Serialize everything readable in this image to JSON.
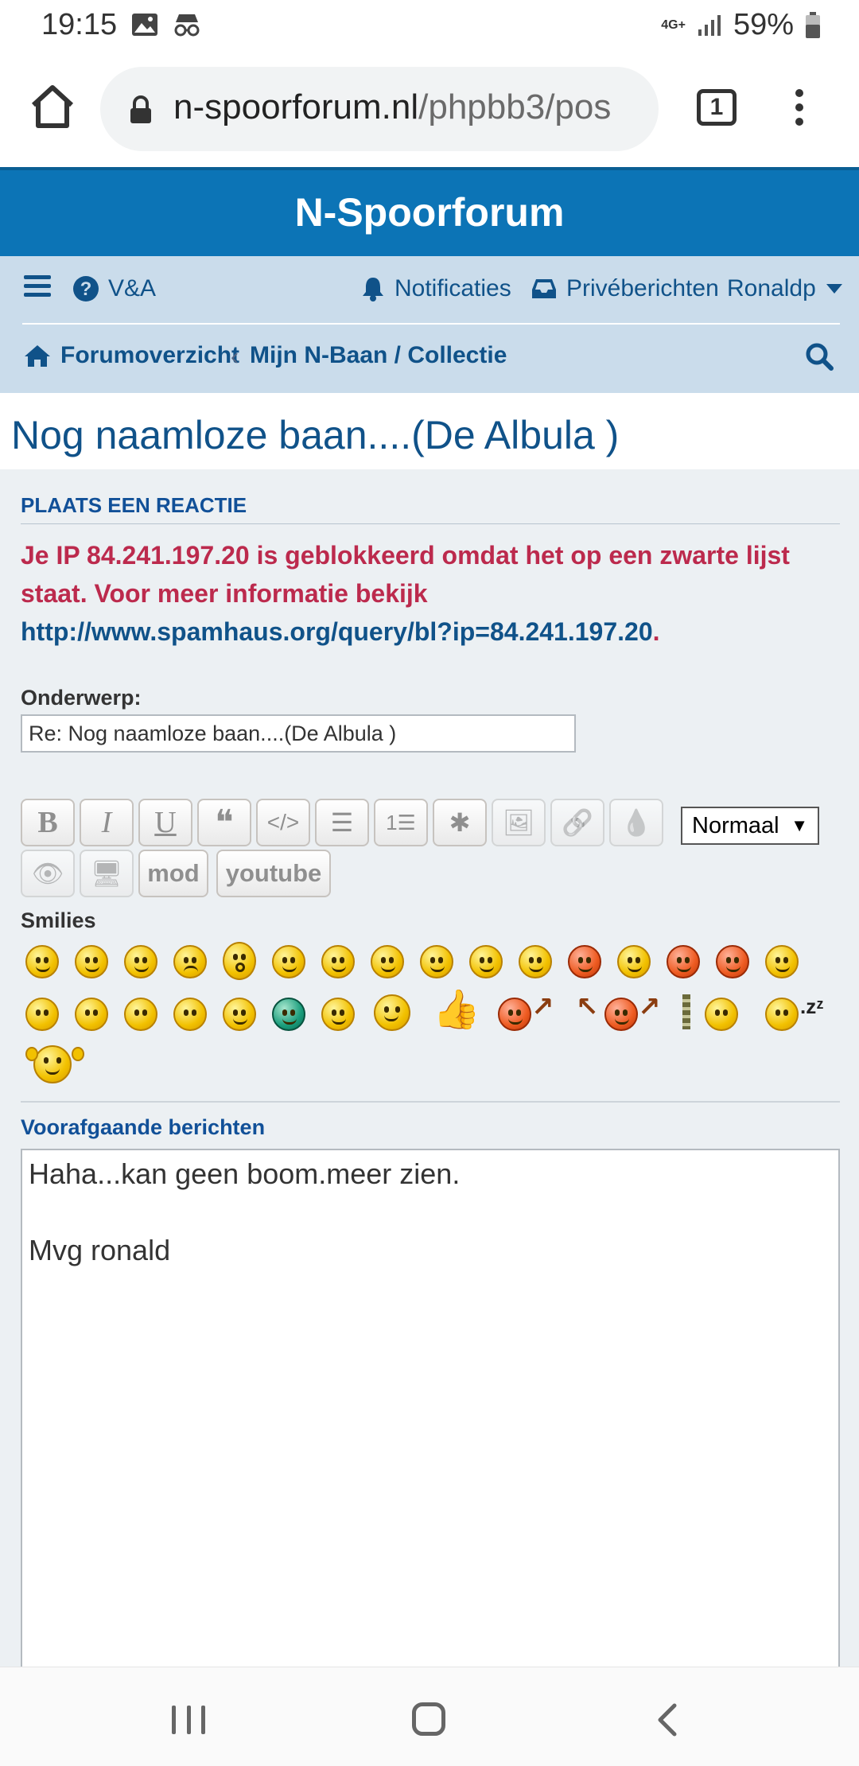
{
  "status_bar": {
    "time": "19:15",
    "network": "4G+",
    "battery": "59%"
  },
  "browser": {
    "url_domain": "n-spoorforum.nl",
    "url_path": "/phpbb3/pos",
    "tab_count": "1"
  },
  "site": {
    "title": "N-Spoorforum"
  },
  "nav": {
    "faq": "V&A",
    "notifications": "Notificaties",
    "private_messages": "Privéberichten",
    "username": "Ronaldp",
    "breadcrumb_home": "Forumoverzicht",
    "breadcrumb_sep": "‹",
    "breadcrumb_forum": "Mijn N-Baan / Collectie"
  },
  "topic": {
    "title": "Nog naamloze baan....(De Albula )"
  },
  "post_form": {
    "heading": "PLAATS EEN REACTIE",
    "error_text": "Je IP 84.241.197.20 is geblokkeerd omdat het op een zwarte lijst staat. Voor meer informatie bekijk ",
    "error_link": "http://www.spamhaus.org/query/bl?ip=84.241.197.20",
    "error_end": ".",
    "subject_label": "Onderwerp:",
    "subject_value": "Re: Nog naamloze baan....(De Albula )",
    "toolbar": {
      "bold": "B",
      "italic": "I",
      "underline": "U",
      "quote": "❝",
      "code": "</>",
      "list": "☰",
      "list_numbered": "1☰",
      "list_item": "✱",
      "image": "🖼",
      "link": "🔗",
      "color": "💧",
      "spoiler": "👁",
      "screen": "🖥",
      "mod": "mod",
      "youtube": "youtube",
      "font_size": "Normaal",
      "font_size_arrow": "▼"
    },
    "smilies_label": "Smilies",
    "previous_label": "Voorafgaande berichten",
    "previous_messages": [
      "Haha...kan geen boom.meer zien.",
      "Mvg ronald"
    ]
  },
  "icons": {
    "home": "home-icon",
    "lock": "lock-icon",
    "menu": "kebab-menu-icon",
    "hamburger": "hamburger-icon",
    "question": "question-circle-icon",
    "bell": "bell-icon",
    "inbox": "inbox-icon",
    "caret": "caret-down-icon",
    "forum_home": "house-icon",
    "search": "search-icon"
  },
  "colors": {
    "header_blue": "#0c74b6",
    "nav_bg": "#cadceb",
    "link_blue": "#105289",
    "error_red": "#bc2a4d",
    "panel_bg": "#ecf0f3"
  }
}
